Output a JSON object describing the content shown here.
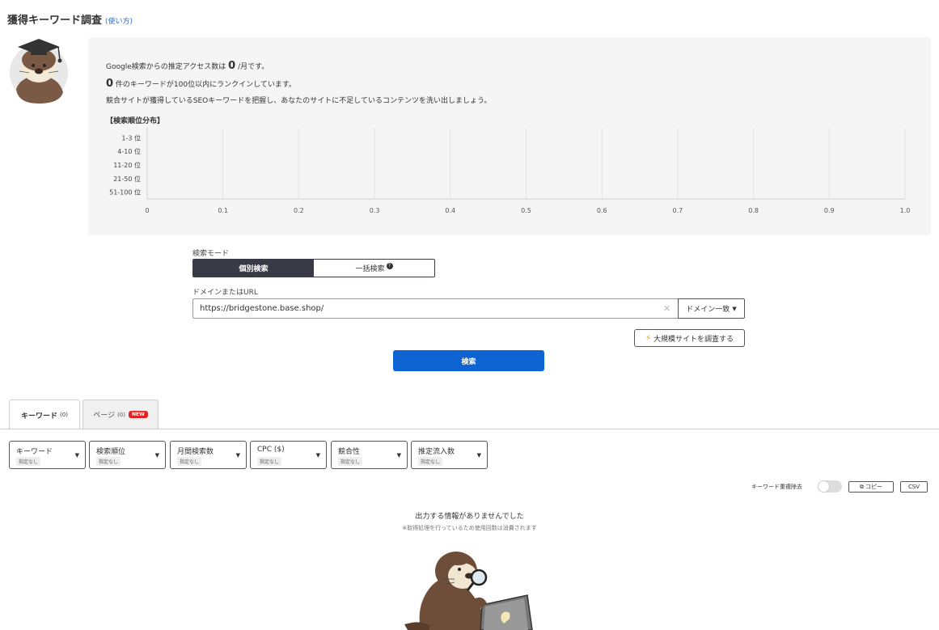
{
  "header": {
    "title": "獲得キーワード調査",
    "howto": "(使い方)"
  },
  "summary": {
    "access_prefix": "Google検索からの推定アクセス数は",
    "access_value": "0",
    "access_suffix": "/月です。",
    "keyword_value": "0",
    "keyword_suffix": "件のキーワードが100位以内にランクインしています。",
    "description": "競合サイトが獲得しているSEOキーワードを把握し、あなたのサイトに不足しているコンテンツを洗い出しましょう。",
    "dist_title": "【検索順位分布】"
  },
  "chart_data": {
    "type": "bar",
    "orientation": "horizontal",
    "categories": [
      "1-3 位",
      "4-10 位",
      "11-20 位",
      "21-50 位",
      "51-100 位"
    ],
    "values": [
      0,
      0,
      0,
      0,
      0
    ],
    "xlim": [
      0,
      1.0
    ],
    "xticks": [
      "0",
      "0.1",
      "0.2",
      "0.3",
      "0.4",
      "0.5",
      "0.6",
      "0.7",
      "0.8",
      "0.9",
      "1.0"
    ],
    "grid": true
  },
  "form": {
    "mode_label": "検索モード",
    "mode_individual": "個別検索",
    "mode_bulk": "一括検索",
    "domain_label": "ドメインまたはURL",
    "url_value": "https://bridgestone.base.shop/",
    "match_select": "ドメイン一致",
    "large_site_button": "大規模サイトを調査する",
    "search_button": "検索"
  },
  "tabs": [
    {
      "label": "キーワード",
      "count": "(0)"
    },
    {
      "label": "ページ",
      "count": "(0)",
      "badge": "NEW"
    }
  ],
  "filters": [
    {
      "label": "キーワード",
      "sub": "指定なし"
    },
    {
      "label": "検索順位",
      "sub": "指定なし"
    },
    {
      "label": "月間検索数",
      "sub": "指定なし"
    },
    {
      "label": "CPC ($)",
      "sub": "指定なし"
    },
    {
      "label": "競合性",
      "sub": "指定なし"
    },
    {
      "label": "推定流入数",
      "sub": "指定なし"
    }
  ],
  "tools": {
    "dedupe_label": "キーワード重複除去",
    "copy_button": "コピー",
    "csv_button": "CSV"
  },
  "empty": {
    "message": "出力する情報がありませんでした",
    "note": "※取得処理を行っているため使用回数は消費されます"
  },
  "colors": {
    "primary": "#0c63d1",
    "dark": "#3a3a46",
    "panel": "#f5f5f5",
    "badge": "#e02424"
  }
}
